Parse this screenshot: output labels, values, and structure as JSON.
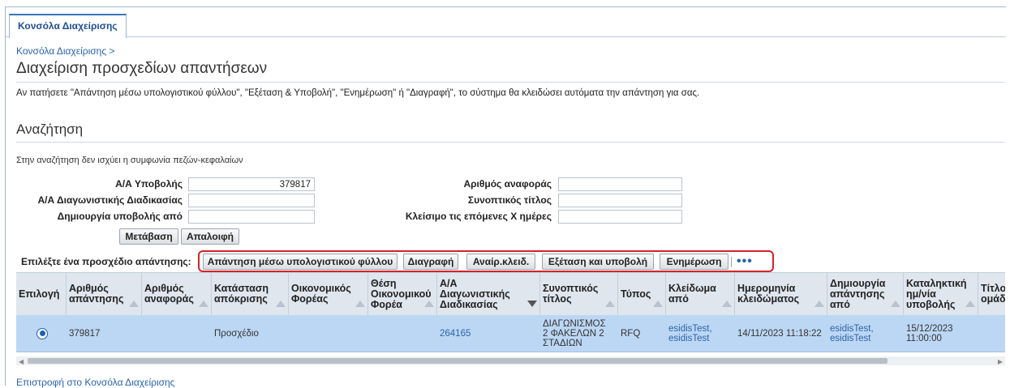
{
  "tab": {
    "label": "Κονσόλα Διαχείρισης"
  },
  "breadcrumb": "Κονσόλα Διαχείρισης >",
  "page_title": "Διαχείριση προσχεδίων απαντήσεων",
  "info_text": "Αν πατήσετε \"Απάντηση μέσω υπολογιστικού φύλλου\", \"Εξέταση & Υποβολή\", \"Ενημέρωση\" ή \"Διαγραφή\", το σύστημα θα κλειδώσει αυτόματα την απάντηση για σας.",
  "search": {
    "title": "Αναζήτηση",
    "note": "Στην αναζήτηση δεν ισχύει η συμφωνία πεζών-κεφαλαίων",
    "fields": {
      "submission_id": {
        "label": "Α/Α Υποβολής",
        "value": "379817"
      },
      "competition_id": {
        "label": "Α/Α Διαγωνιστικής Διαδικασίας",
        "value": ""
      },
      "created_from": {
        "label": "Δημιουργία υποβολής από",
        "value": ""
      },
      "reference_no": {
        "label": "Αριθμός αναφοράς",
        "value": ""
      },
      "short_title": {
        "label": "Συνοπτικός τίτλος",
        "value": ""
      },
      "closing_days": {
        "label": "Κλείσιμο τις επόμενες Χ ημέρες",
        "value": ""
      }
    },
    "go_label": "Μετάβαση",
    "clear_label": "Απαλοιφή"
  },
  "toolbar": {
    "select_label": "Επιλέξτε ένα προσχέδιο απάντησης:",
    "spreadsheet_label": "Απάντηση μέσω υπολογιστικού φύλλου",
    "delete_label": "Διαγραφή",
    "unlock_label": "Αναίρ.κλειδ.",
    "review_label": "Εξέταση και υποβολή",
    "update_label": "Ενημέρωση",
    "more_label": "•••"
  },
  "table": {
    "headers": [
      "Επιλογή",
      "Αριθμός απάντησης",
      "Αριθμός αναφοράς",
      "Κατάσταση απόκρισης",
      "Οικονομικός Φορέας",
      "Θέση Οικονομικού Φορέα",
      "Α/Α Διαγωνιστικής Διαδικασίας",
      "Συνοπτικός τίτλος",
      "Τύπος",
      "Κλείδωμα από",
      "Ημερομηνία κλειδώματος",
      "Δημιουργία απάντησης από",
      "Καταληκτική ημ/νία υποβολής",
      "Τίτλος ομάδ"
    ],
    "rows": [
      {
        "response_no": "379817",
        "reference_no": "",
        "status": "Προσχέδιο",
        "supplier": "",
        "supplier_site": "",
        "competition_no": "264165",
        "title": "ΔΙΑΓΩΝΙΣΜΟΣ 2 ΦΑΚΕΛΩΝ 2 ΣΤΑΔΙΩΝ",
        "type": "RFQ",
        "locked_by": "esidisTest, esidisTest",
        "lock_date": "14/11/2023 11:18:22",
        "created_by": "esidisTest, esidisTest",
        "close_date": "15/12/2023 11:00:00",
        "group_title": ""
      }
    ]
  },
  "return_link": "Επιστροφή στο Κονσόλα Διαχείρισης",
  "colors": {
    "accent": "#3b73b9",
    "link": "#2b63a8",
    "selected_row": "#bcd7f4",
    "highlight_box": "#d2232a"
  }
}
